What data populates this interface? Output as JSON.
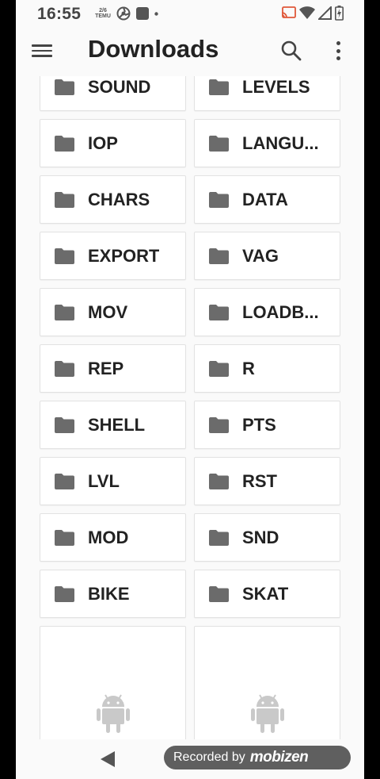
{
  "status_bar": {
    "time": "16:55",
    "left_icons": [
      "data-usage-icon",
      "settings-icon",
      "square-app-icon",
      "dot-icon"
    ],
    "left_icon_text": "2/6\nTEMU",
    "right_icons": [
      "cast-icon",
      "wifi-icon",
      "signal-icon",
      "battery-icon"
    ]
  },
  "app_bar": {
    "title": "Downloads",
    "menu_icon": "hamburger-menu-icon",
    "search_icon": "search-icon",
    "more_icon": "more-vert-icon"
  },
  "folders": [
    {
      "label": "SOUND"
    },
    {
      "label": "LEVELS"
    },
    {
      "label": "IOP"
    },
    {
      "label": "LANGU..."
    },
    {
      "label": "CHARS"
    },
    {
      "label": "DATA"
    },
    {
      "label": "EXPORT"
    },
    {
      "label": "VAG"
    },
    {
      "label": "MOV"
    },
    {
      "label": "LOADB..."
    },
    {
      "label": "REP"
    },
    {
      "label": "R"
    },
    {
      "label": "SHELL"
    },
    {
      "label": "PTS"
    },
    {
      "label": "LVL"
    },
    {
      "label": "RST"
    },
    {
      "label": "MOD"
    },
    {
      "label": "SND"
    },
    {
      "label": "BIKE"
    },
    {
      "label": "SKAT"
    }
  ],
  "files": [
    {
      "icon": "android-icon"
    },
    {
      "icon": "android-icon"
    }
  ],
  "nav_bar": {
    "back_icon": "back-triangle-icon",
    "watermark_recorded": "Recorded by",
    "watermark_brand": "mobizen"
  },
  "colors": {
    "folder_icon": "#6b6b6b",
    "android_icon": "#c9c9c9",
    "tile_border": "#e2e2e2",
    "background": "#fafafa"
  }
}
